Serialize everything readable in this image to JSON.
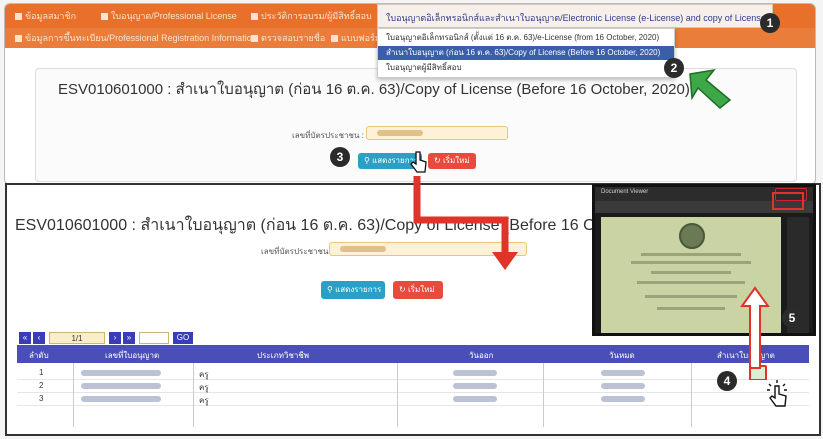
{
  "nav": {
    "row1": [
      "ข้อมูลสมาชิก",
      "ใบอนุญาต/Professional License",
      "ประวัติการอบรม/ผู้มีสิทธิ์สอบ"
    ],
    "row2": [
      "ข้อมูลการขึ้นทะเบียน/Professional Registration Information",
      "ตรวจสอบรายชื่อ",
      "แบบฟอร์ม"
    ],
    "selected": "ใบอนุญาตอิเล็กทรอนิกส์และสำเนาใบอนุญาต/Electronic License (e-License) and copy of License",
    "dropdown": [
      "ใบอนุญาตอิเล็กทรอนิกส์ (ตั้งแต่ 16 ต.ค. 63)/e-License (from 16 October, 2020)",
      "สำเนาใบอนุญาต (ก่อน 16 ต.ค. 63)/Copy of License (Before 16 October, 2020)",
      "ใบอนุญาตผู้มีสิทธิ์สอบ"
    ]
  },
  "top": {
    "title": "ESV010601000 : สำเนาใบอนุญาต (ก่อน 16 ต.ค. 63)/Copy of License (Before 16 October, 2020)",
    "id_label": "เลขที่บัตรประชาชน :",
    "search_label": "แสดงรายการ",
    "reset_label": "เริ่มใหม่"
  },
  "bottom": {
    "title": "ESV010601000 : สำเนาใบอนุญาต (ก่อน 16 ต.ค. 63)/Copy of License (Before 16 October, 2020)",
    "id_label": "เลขที่บัตรประชาชน :",
    "search_label": "แสดงรายการ",
    "reset_label": "เริ่มใหม่",
    "pager": {
      "page": "1/1",
      "go": "GO"
    },
    "table": {
      "headers": [
        "ลำดับ",
        "เลขที่ใบอนุญาต",
        "ประเภทวิชาชีพ",
        "วันออก",
        "วันหมด",
        "สำเนาใบอนุญาต"
      ],
      "rows": [
        {
          "no": "1",
          "type": "ครู"
        },
        {
          "no": "2",
          "type": "ครู"
        },
        {
          "no": "3",
          "type": "ครู"
        }
      ]
    }
  },
  "viewer": {
    "title": "Document Viewer"
  },
  "steps": [
    "1",
    "2",
    "3",
    "4",
    "5"
  ],
  "colors": {
    "nav": "#e8702a",
    "search_button": "#2aa1c4",
    "reset_button": "#e94a3e",
    "table_header": "#4a4fb8",
    "arrow_red": "#e0332a",
    "arrow_green": "#2e9a3a"
  },
  "icons": [
    "search-icon",
    "refresh-icon",
    "pointer-cursor-icon",
    "print-icon",
    "arrow-icon"
  ]
}
